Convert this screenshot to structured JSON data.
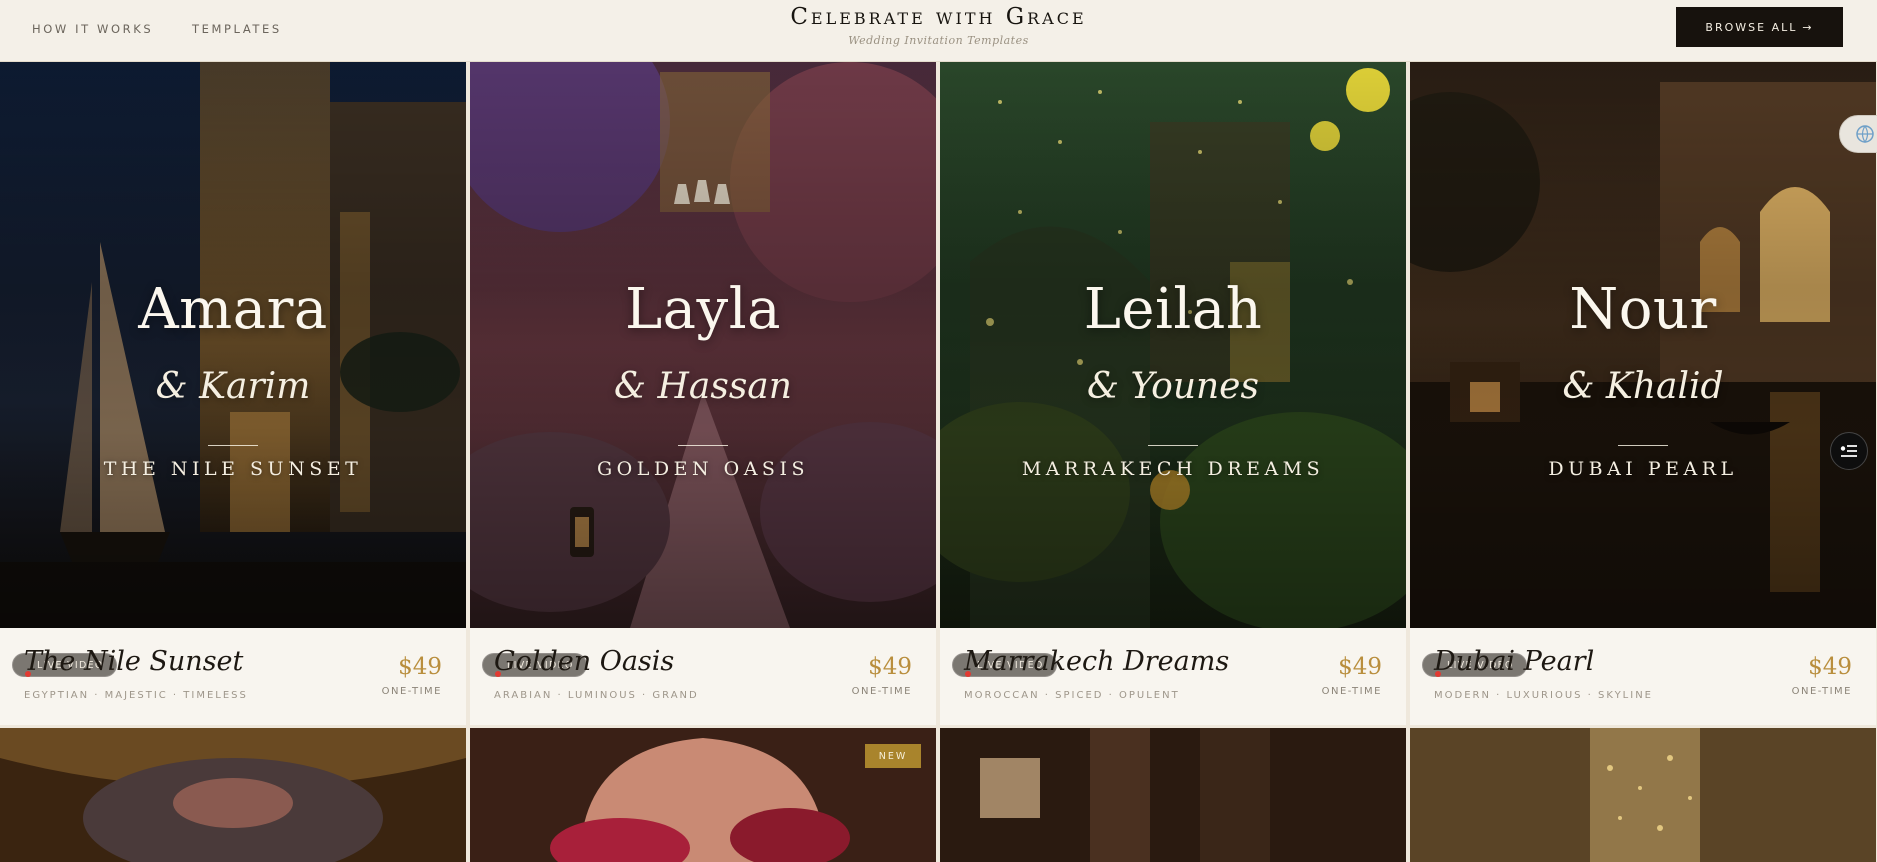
{
  "header": {
    "nav": [
      "How it works",
      "Templates"
    ],
    "brand_title": "Celebrate with Grace",
    "brand_subtitle": "Wedding Invitation Templates",
    "browse_label": "BROWSE ALL",
    "browse_arrow": "→"
  },
  "cards": [
    {
      "first_name": "Amara",
      "partner": "& Karim",
      "theme": "The Nile Sunset",
      "badge": "Live video",
      "title": "The Nile Sunset",
      "tags": "Egyptian · Majestic · Timeless",
      "price": "$49",
      "price_note": "One-time"
    },
    {
      "first_name": "Layla",
      "partner": "& Hassan",
      "theme": "Golden Oasis",
      "badge": "Live video",
      "title": "Golden Oasis",
      "tags": "Arabian · Luminous · Grand",
      "price": "$49",
      "price_note": "One-time"
    },
    {
      "first_name": "Leilah",
      "partner": "& Younes",
      "theme": "Marrakech Dreams",
      "badge": "Live video",
      "title": "Marrakech Dreams",
      "tags": "Moroccan · Spiced · Opulent",
      "price": "$49",
      "price_note": "One-time"
    },
    {
      "first_name": "Nour",
      "partner": "& Khalid",
      "theme": "Dubai Pearl",
      "badge": "Live video",
      "title": "Dubai Pearl",
      "tags": "Modern · Luxurious · Skyline",
      "price": "$49",
      "price_note": "One-time"
    }
  ],
  "lower_row": {
    "new_badge": "NEW"
  },
  "icons": {
    "side_widget": "globe-icon",
    "menu_widget": "filter-list-icon"
  }
}
